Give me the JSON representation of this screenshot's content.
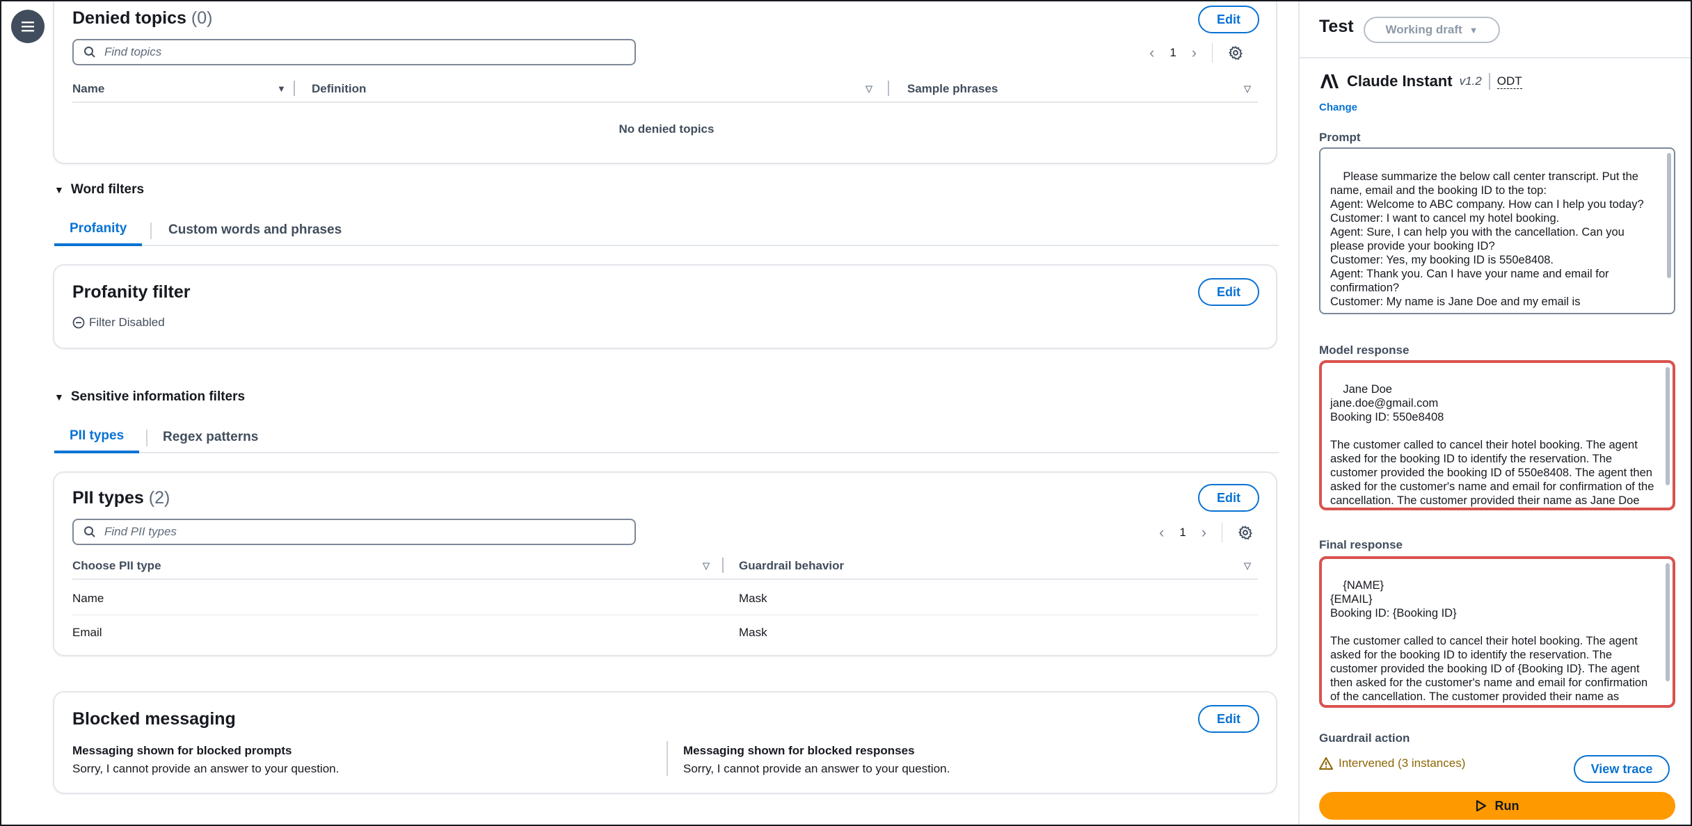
{
  "denied_topics": {
    "title": "Denied topics",
    "count": "(0)",
    "edit_label": "Edit",
    "search_placeholder": "Find topics",
    "page": "1",
    "columns": [
      "Name",
      "Definition",
      "Sample phrases"
    ],
    "empty_text": "No denied topics"
  },
  "word_filters": {
    "section_label": "Word filters",
    "tabs": [
      "Profanity",
      "Custom words and phrases"
    ],
    "active_tab": "Profanity",
    "profanity": {
      "title": "Profanity filter",
      "edit_label": "Edit",
      "status": "Filter Disabled"
    }
  },
  "sensitive_info": {
    "section_label": "Sensitive information filters",
    "tabs": [
      "PII types",
      "Regex patterns"
    ],
    "active_tab": "PII types",
    "pii": {
      "title": "PII types",
      "count": "(2)",
      "edit_label": "Edit",
      "search_placeholder": "Find PII types",
      "page": "1",
      "columns": [
        "Choose PII type",
        "Guardrail behavior"
      ],
      "rows": [
        {
          "type": "Name",
          "behavior": "Mask"
        },
        {
          "type": "Email",
          "behavior": "Mask"
        }
      ]
    }
  },
  "blocked_messaging": {
    "title": "Blocked messaging",
    "edit_label": "Edit",
    "prompts_label": "Messaging shown for blocked prompts",
    "prompts_text": "Sorry, I cannot provide an answer to your question.",
    "responses_label": "Messaging shown for blocked responses",
    "responses_text": "Sorry, I cannot provide an answer to your question."
  },
  "test_panel": {
    "title": "Test",
    "draft_select": "Working draft",
    "model_name": "Claude Instant",
    "model_version": "v1.2",
    "model_mode": "ODT",
    "change_label": "Change",
    "prompt_label": "Prompt",
    "prompt_text": "Please summarize the below call center transcript. Put the name, email and the booking ID to the top:\nAgent: Welcome to ABC company. How can I help you today?\nCustomer: I want to cancel my hotel booking.\nAgent: Sure, I can help you with the cancellation. Can you please provide your booking ID?\nCustomer: Yes, my booking ID is 550e8408.\nAgent: Thank you. Can I have your name and email for confirmation?\nCustomer: My name is Jane Doe and my email is",
    "model_response_label": "Model response",
    "model_response_text": "Jane Doe\njane.doe@gmail.com\nBooking ID: 550e8408\n\nThe customer called to cancel their hotel booking. The agent asked for the booking ID to identify the reservation. The customer provided the booking ID of 550e8408. The agent then asked for the customer's name and email for confirmation of the cancellation. The customer provided their name as Jane Doe and email as jane.doe@gmail.com.",
    "final_response_label": "Final response",
    "final_response_text": "{NAME}\n{EMAIL}\nBooking ID: {Booking ID}\n\nThe customer called to cancel their hotel booking. The agent asked for the booking ID to identify the reservation. The customer provided the booking ID of {Booking ID}. The agent then asked for the customer's name and email for confirmation of the cancellation. The customer provided their name as {NAME} and email as {EMAIL}. The agent",
    "guardrail_action_label": "Guardrail action",
    "guardrail_status": "Intervened (3 instances)",
    "view_trace_label": "View trace",
    "run_label": "Run"
  },
  "colors": {
    "accent": "#0972d3",
    "run_button": "#ff9900",
    "highlight_border": "#d9534f",
    "warning": "#8d6605"
  },
  "icons": [
    "menu-icon",
    "search-icon",
    "settings-gear-icon",
    "chevron-left-icon",
    "chevron-right-icon",
    "sort-caret-icon",
    "minus-circle-icon",
    "warning-icon",
    "play-icon",
    "anthropic-logo-icon",
    "caret-down-icon"
  ]
}
